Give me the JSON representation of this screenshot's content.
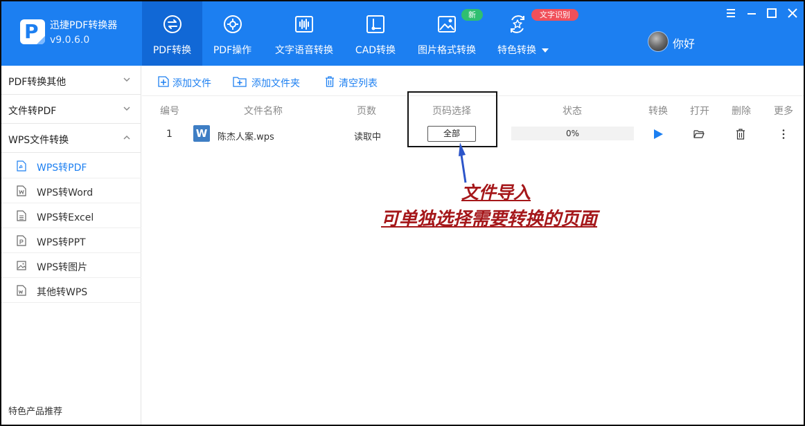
{
  "app": {
    "name": "迅捷PDF转换器",
    "version": "v9.0.6.0",
    "brand_color": "#1c7ff1",
    "active_tab_color": "#1168d6"
  },
  "header": {
    "tabs": [
      {
        "label": "PDF转换",
        "icon": "pdf-convert-icon",
        "active": true
      },
      {
        "label": "PDF操作",
        "icon": "gear-circle-icon",
        "active": false
      },
      {
        "label": "文字语音转换",
        "icon": "audio-wave-icon",
        "active": false
      },
      {
        "label": "CAD转换",
        "icon": "cad-icon",
        "active": false
      },
      {
        "label": "图片格式转换",
        "icon": "image-icon",
        "active": false
      },
      {
        "label": "特色转换",
        "icon": "star-refresh-icon",
        "active": false
      }
    ],
    "badges": {
      "new": "新",
      "new_color": "#2fbf71",
      "ocr": "文字识别",
      "ocr_color": "#f0505a"
    },
    "user": {
      "name": "你好"
    }
  },
  "sidebar": {
    "groups": [
      {
        "label": "PDF转换其他",
        "expanded": false
      },
      {
        "label": "文件转PDF",
        "expanded": false
      },
      {
        "label": "WPS文件转换",
        "expanded": true
      }
    ],
    "items": [
      {
        "label": "WPS转PDF",
        "icon": "pdf-file-icon",
        "active": true
      },
      {
        "label": "WPS转Word",
        "icon": "word-file-icon",
        "active": false
      },
      {
        "label": "WPS转Excel",
        "icon": "excel-file-icon",
        "active": false
      },
      {
        "label": "WPS转PPT",
        "icon": "ppt-file-icon",
        "active": false
      },
      {
        "label": "WPS转图片",
        "icon": "image-file-icon",
        "active": false
      },
      {
        "label": "其他转WPS",
        "icon": "wps-file-icon",
        "active": false
      }
    ],
    "footer": "特色产品推荐"
  },
  "toolbar": {
    "add_file": "添加文件",
    "add_folder": "添加文件夹",
    "clear_list": "清空列表"
  },
  "table": {
    "columns": [
      "编号",
      "文件名称",
      "页数",
      "页码选择",
      "状态",
      "转换",
      "打开",
      "删除",
      "更多"
    ],
    "rows": [
      {
        "index": "1",
        "file_icon": "W",
        "filename": "陈杰人案.wps",
        "pages": "读取中",
        "page_select": "全部",
        "status": "0%",
        "progress": 0
      }
    ]
  },
  "annotation": {
    "line1": "文件导入",
    "line2": "可单独选择需要转换的页面",
    "color": "#a5171a"
  }
}
